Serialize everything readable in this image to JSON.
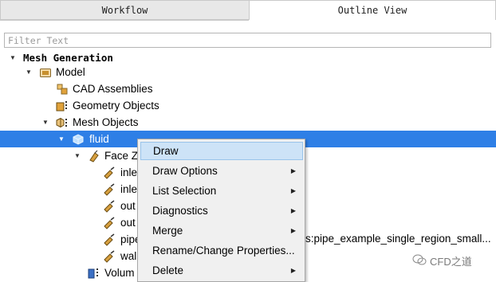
{
  "tabs": {
    "workflow": "Workflow",
    "outline": "Outline View"
  },
  "filter": {
    "placeholder": "Filter Text"
  },
  "tree": {
    "mesh_generation": "Mesh Generation",
    "model": "Model",
    "cad_assemblies": "CAD Assemblies",
    "geometry_objects": "Geometry Objects",
    "mesh_objects": "Mesh Objects",
    "fluid": "fluid",
    "face_zones": "Face Z",
    "items": [
      "inle",
      "inle",
      "out",
      "out",
      "pipe",
      "wal"
    ],
    "volume": "Volum",
    "pipe_trailing": "s:pipe_example_single_region_small..."
  },
  "context_menu": {
    "items": [
      {
        "label": "Draw",
        "submenu": false
      },
      {
        "label": "Draw Options",
        "submenu": true
      },
      {
        "label": "List Selection",
        "submenu": true
      },
      {
        "label": "Diagnostics",
        "submenu": true
      },
      {
        "label": "Merge",
        "submenu": true
      },
      {
        "label": "Rename/Change Properties...",
        "submenu": false
      },
      {
        "label": "Delete",
        "submenu": true
      }
    ],
    "highlighted": "Draw"
  },
  "watermark": "CFD之道",
  "colors": {
    "selection": "#2e7fe6",
    "menu_highlight": "#cde3f7",
    "zone_icon": "#b8862b"
  }
}
